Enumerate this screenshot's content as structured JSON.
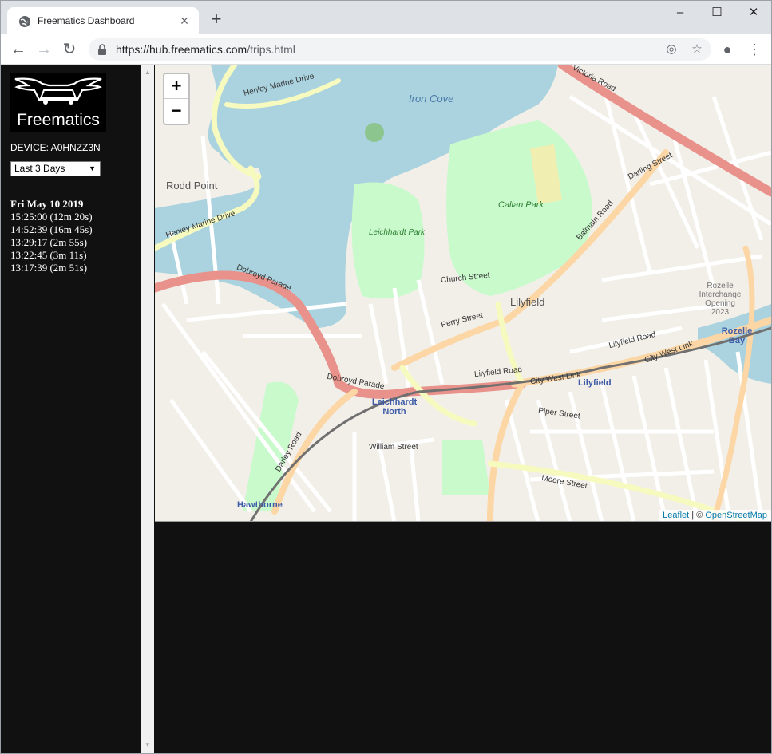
{
  "browser": {
    "tab_title": "Freematics Dashboard",
    "new_tab_label": "+",
    "url_host": "https://hub.freematics.com",
    "url_path": "/trips.html"
  },
  "sidebar": {
    "logo_text": "Freematics",
    "device_label": "DEVICE: A0HNZZ3N",
    "range_select": "Last 3 Days",
    "trip_date": "Fri May 10 2019",
    "trips": [
      "15:25:00 (12m 20s)",
      "14:52:39 (16m 45s)",
      "13:29:17 (2m 55s)",
      "13:22:45 (3m 11s)",
      "13:17:39 (2m 51s)"
    ]
  },
  "map": {
    "zoom_in": "+",
    "zoom_out": "−",
    "attribution_leaflet": "Leaflet",
    "attribution_sep": " | © ",
    "attribution_osm": "OpenStreetMap",
    "labels": {
      "iron_cove": "Iron Cove",
      "rodd_point": "Rodd Point",
      "callan_park": "Callan Park",
      "leichhardt_park": "Leichhardt Park",
      "lilyfield": "Lilyfield",
      "lilyfield_station": "Lilyfield",
      "leichhardt_north": "Leichhardt North",
      "hawthorne": "Hawthorne",
      "rozelle_bay": "Rozelle Bay",
      "victoria_road": "Victoria Road",
      "darling_street": "Darling Street",
      "balmain_road": "Balmain Road",
      "dobroyd_parade": "Dobroyd Parade",
      "henley_marine_drive": "Henley Marine Drive",
      "lilyfield_road": "Lilyfield Road",
      "city_west_link": "City West Link",
      "perry_street": "Perry Street",
      "moore_street": "Moore Street",
      "darley_road": "Darley Road",
      "church_street": "Church Street",
      "piper_street": "Piper Street",
      "william_street": "William Street",
      "rozelle_interchange": "Rozelle Interchange Opening 2023"
    }
  }
}
